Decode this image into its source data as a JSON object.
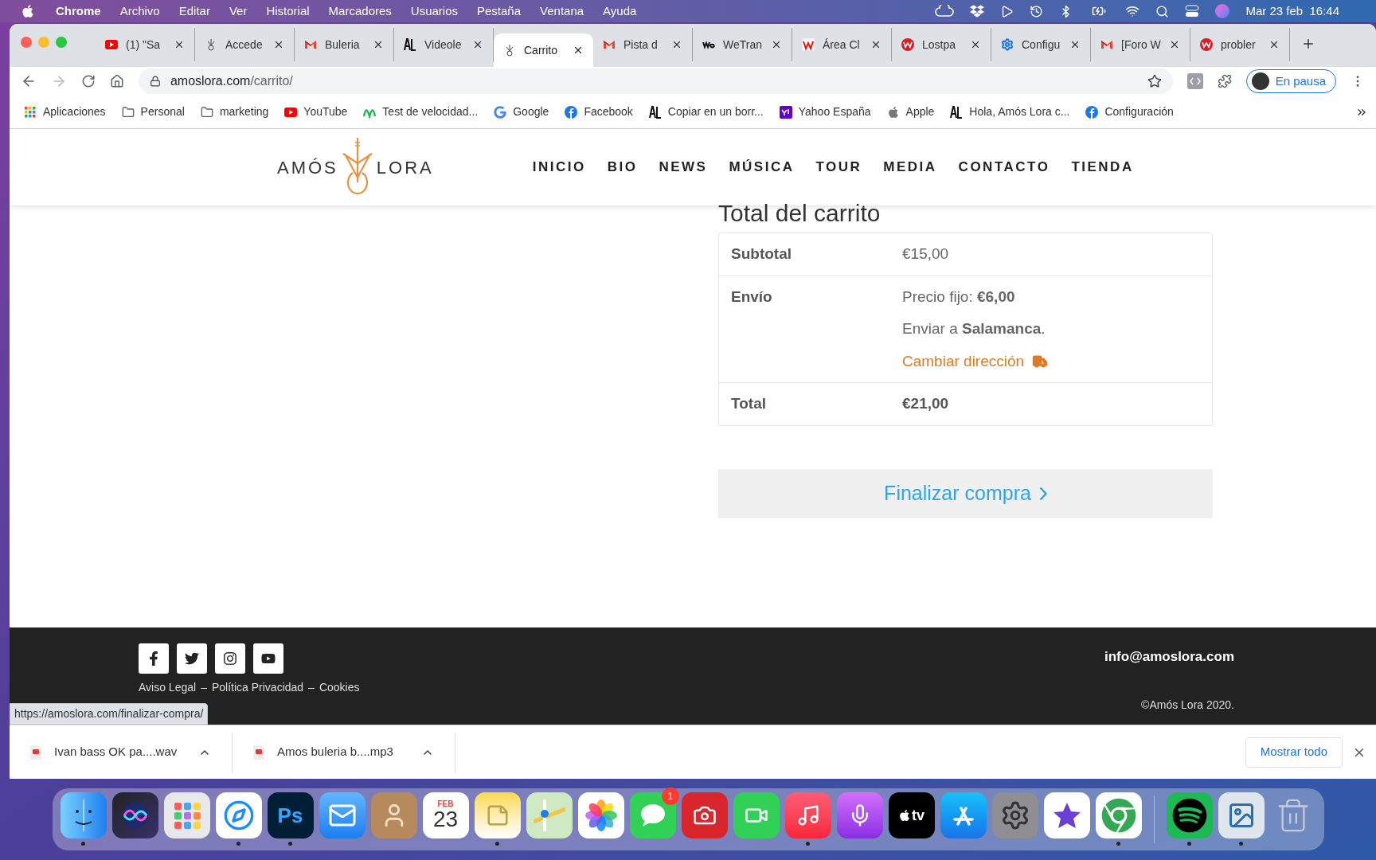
{
  "menubar": {
    "app": "Chrome",
    "menus": [
      "Archivo",
      "Editar",
      "Ver",
      "Historial",
      "Marcadores",
      "Usuarios",
      "Pestaña",
      "Ventana",
      "Ayuda"
    ],
    "date": "Mar 23 feb",
    "time": "16:44"
  },
  "tabs": [
    {
      "title": "(1) \"Sa",
      "kind": "video",
      "selected": false
    },
    {
      "title": "Accede",
      "kind": "guitar",
      "selected": false
    },
    {
      "title": "Buleria",
      "kind": "mail",
      "selected": false
    },
    {
      "title": "Videole",
      "kind": "letters",
      "selected": false
    },
    {
      "title": "Carrito",
      "kind": "guitar",
      "selected": true
    },
    {
      "title": "Pista d",
      "kind": "mail",
      "selected": false
    },
    {
      "title": "WeTran",
      "kind": "we",
      "selected": false
    },
    {
      "title": "Área Cl",
      "kind": "w",
      "selected": false
    },
    {
      "title": "Lostpa",
      "kind": "round",
      "selected": false
    },
    {
      "title": "Configu",
      "kind": "gear",
      "selected": false
    },
    {
      "title": "[Foro W",
      "kind": "mail",
      "selected": false
    },
    {
      "title": "probler",
      "kind": "round",
      "selected": false
    }
  ],
  "address": {
    "host": "amoslora.com",
    "path": "/carrito/"
  },
  "profile": {
    "label": "En pausa"
  },
  "bookmarks": [
    {
      "label": "Aplicaciones",
      "kind": "grid"
    },
    {
      "label": "Personal",
      "kind": "folder"
    },
    {
      "label": "marketing",
      "kind": "folder"
    },
    {
      "label": "YouTube",
      "kind": "video"
    },
    {
      "label": "Test de velocidad...",
      "kind": "m"
    },
    {
      "label": "Google",
      "kind": "g"
    },
    {
      "label": "Facebook",
      "kind": "f"
    },
    {
      "label": "Copiar en un borr...",
      "kind": "letters"
    },
    {
      "label": "Yahoo España",
      "kind": "y"
    },
    {
      "label": "Apple",
      "kind": "apple"
    },
    {
      "label": "Hola, Amós Lora c...",
      "kind": "letters"
    },
    {
      "label": "Configuración",
      "kind": "f"
    }
  ],
  "site": {
    "logo_left": "AMÓS",
    "logo_right": "LORA",
    "nav": [
      "INICIO",
      "BIO",
      "NEWS",
      "MÚSICA",
      "TOUR",
      "MEDIA",
      "CONTACTO",
      "TIENDA"
    ]
  },
  "cart": {
    "heading": "Total del carrito",
    "rows": [
      {
        "label": "Subtotal",
        "kind": "plain",
        "value": "€15,00"
      },
      {
        "label": "Envío",
        "kind": "shipping",
        "lines": [
          "Precio fijo: **€6,00**",
          "Enviar a **Salamanca**."
        ],
        "link": "Cambiar dirección"
      },
      {
        "label": "Total",
        "kind": "total",
        "value": "€21,00"
      }
    ],
    "checkout": "Finalizar compra"
  },
  "footer": {
    "email": "info@amoslora.com",
    "links": [
      "Aviso Legal",
      "Política Privacidad",
      "Cookies"
    ],
    "separator": "–",
    "copyright": "©Amós Lora 2020."
  },
  "status_url": "https://amoslora.com/finalizar-compra/",
  "downloads": {
    "items": [
      "Ivan bass OK pa....wav",
      "Amos buleria  b....mp3"
    ],
    "show_all": "Mostrar todo"
  },
  "dock": [
    {
      "kind": "finder",
      "running": true
    },
    {
      "kind": "siri",
      "running": false
    },
    {
      "kind": "launchpad",
      "running": false
    },
    {
      "kind": "safari",
      "running": true
    },
    {
      "kind": "ps",
      "running": true,
      "text": "Ps"
    },
    {
      "kind": "mail",
      "running": false
    },
    {
      "kind": "contacts",
      "running": false
    },
    {
      "kind": "calendar",
      "running": false,
      "month": "FEB",
      "day": "23"
    },
    {
      "kind": "notes",
      "running": true
    },
    {
      "kind": "maps",
      "running": false
    },
    {
      "kind": "photos",
      "running": false
    },
    {
      "kind": "messages",
      "running": false,
      "badge": "1"
    },
    {
      "kind": "booth",
      "running": false
    },
    {
      "kind": "facetime",
      "running": false
    },
    {
      "kind": "music",
      "running": true
    },
    {
      "kind": "podcasts",
      "running": false
    },
    {
      "kind": "tv",
      "running": false,
      "text": "tv"
    },
    {
      "kind": "store",
      "running": false
    },
    {
      "kind": "settings",
      "running": false
    },
    {
      "kind": "star",
      "running": false
    },
    {
      "kind": "chrome",
      "running": true
    },
    {
      "kind": "sep"
    },
    {
      "kind": "spotify",
      "running": true
    },
    {
      "kind": "preview",
      "running": true
    },
    {
      "kind": "trash",
      "running": false
    }
  ]
}
